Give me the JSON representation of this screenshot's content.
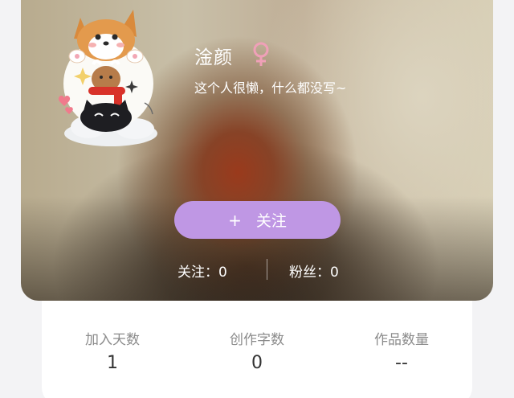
{
  "profile": {
    "username": "淦颜",
    "gender_icon": "female-icon",
    "bio": "这个人很懒，什么都没写~"
  },
  "follow_button": {
    "plus": "+",
    "label": "关注"
  },
  "stats": {
    "following": "关注：0",
    "followers": "粉丝：0"
  },
  "info": [
    {
      "label": "加入天数",
      "value": "1"
    },
    {
      "label": "创作字数",
      "value": "0"
    },
    {
      "label": "作品数量",
      "value": "--"
    }
  ],
  "colors": {
    "button": "#bf97e4",
    "gender": "#f0a0b8"
  }
}
